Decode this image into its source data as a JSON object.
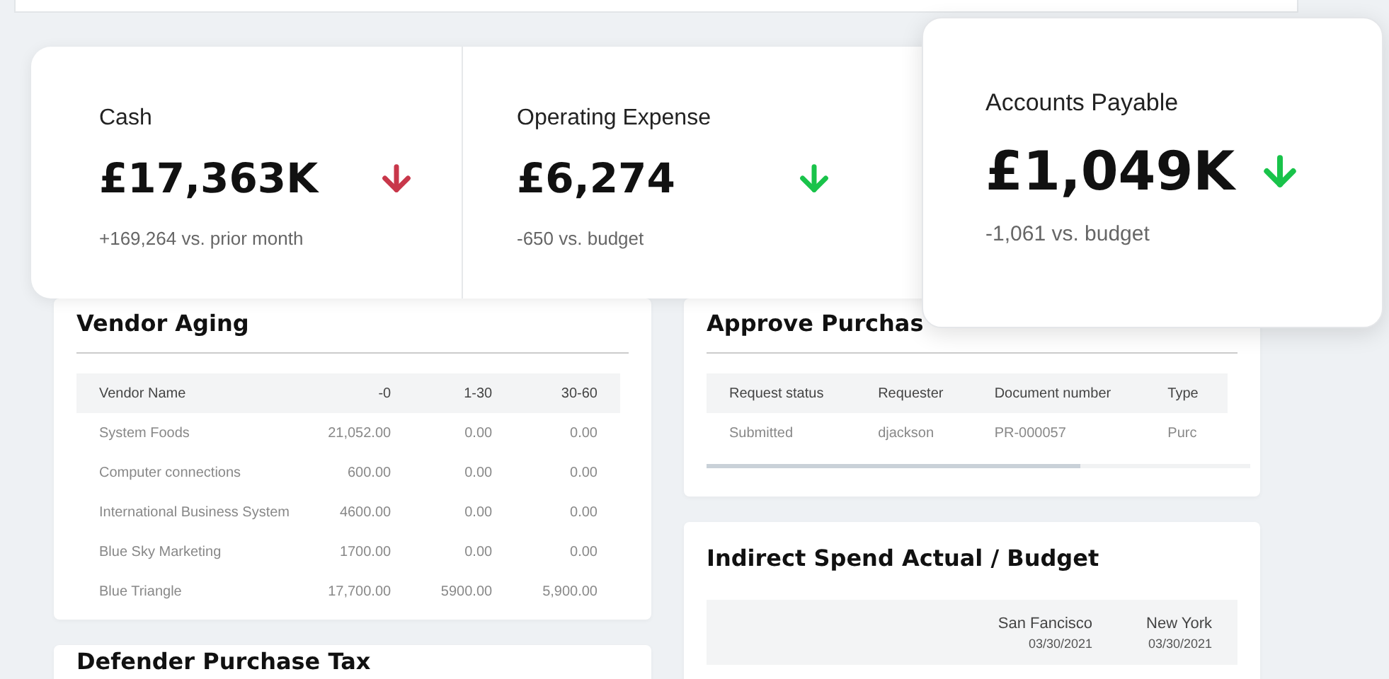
{
  "kpis": [
    {
      "label": "Cash",
      "value": "£17,363K",
      "down": true,
      "good": false,
      "note": "+169,264 vs. prior month"
    },
    {
      "label": "Operating Expense",
      "value": "£6,274",
      "down": true,
      "good": true,
      "note": "-650 vs. budget"
    }
  ],
  "featured_kpi": {
    "label": "Accounts Payable",
    "value": "£1,049K",
    "down": true,
    "good": true,
    "note": "-1,061 vs. budget"
  },
  "vendor_aging": {
    "title": "Vendor Aging",
    "columns": [
      "Vendor Name",
      "-0",
      "1-30",
      "30-60"
    ],
    "rows": [
      [
        "System Foods",
        "21,052.00",
        "0.00",
        "0.00"
      ],
      [
        "Computer connections",
        "600.00",
        "0.00",
        "0.00"
      ],
      [
        "International Business System",
        "4600.00",
        "0.00",
        "0.00"
      ],
      [
        "Blue Sky Marketing",
        "1700.00",
        "0.00",
        "0.00"
      ],
      [
        "Blue Triangle",
        "17,700.00",
        "5900.00",
        "5,900.00"
      ]
    ]
  },
  "defender_panel": {
    "title": "Defender Purchase Tax"
  },
  "approve_purchasing": {
    "title": "Approve Purchas",
    "columns": [
      "Request status",
      "Requester",
      "Document number",
      "Type"
    ],
    "rows": [
      [
        "Submitted",
        "djackson",
        "PR-000057",
        "Purc"
      ]
    ]
  },
  "indirect_spend": {
    "title": "Indirect Spend Actual / Budget",
    "columns": [
      {
        "city": "San Fancisco",
        "date": "03/30/2021"
      },
      {
        "city": "New York",
        "date": "03/30/2021"
      }
    ]
  }
}
